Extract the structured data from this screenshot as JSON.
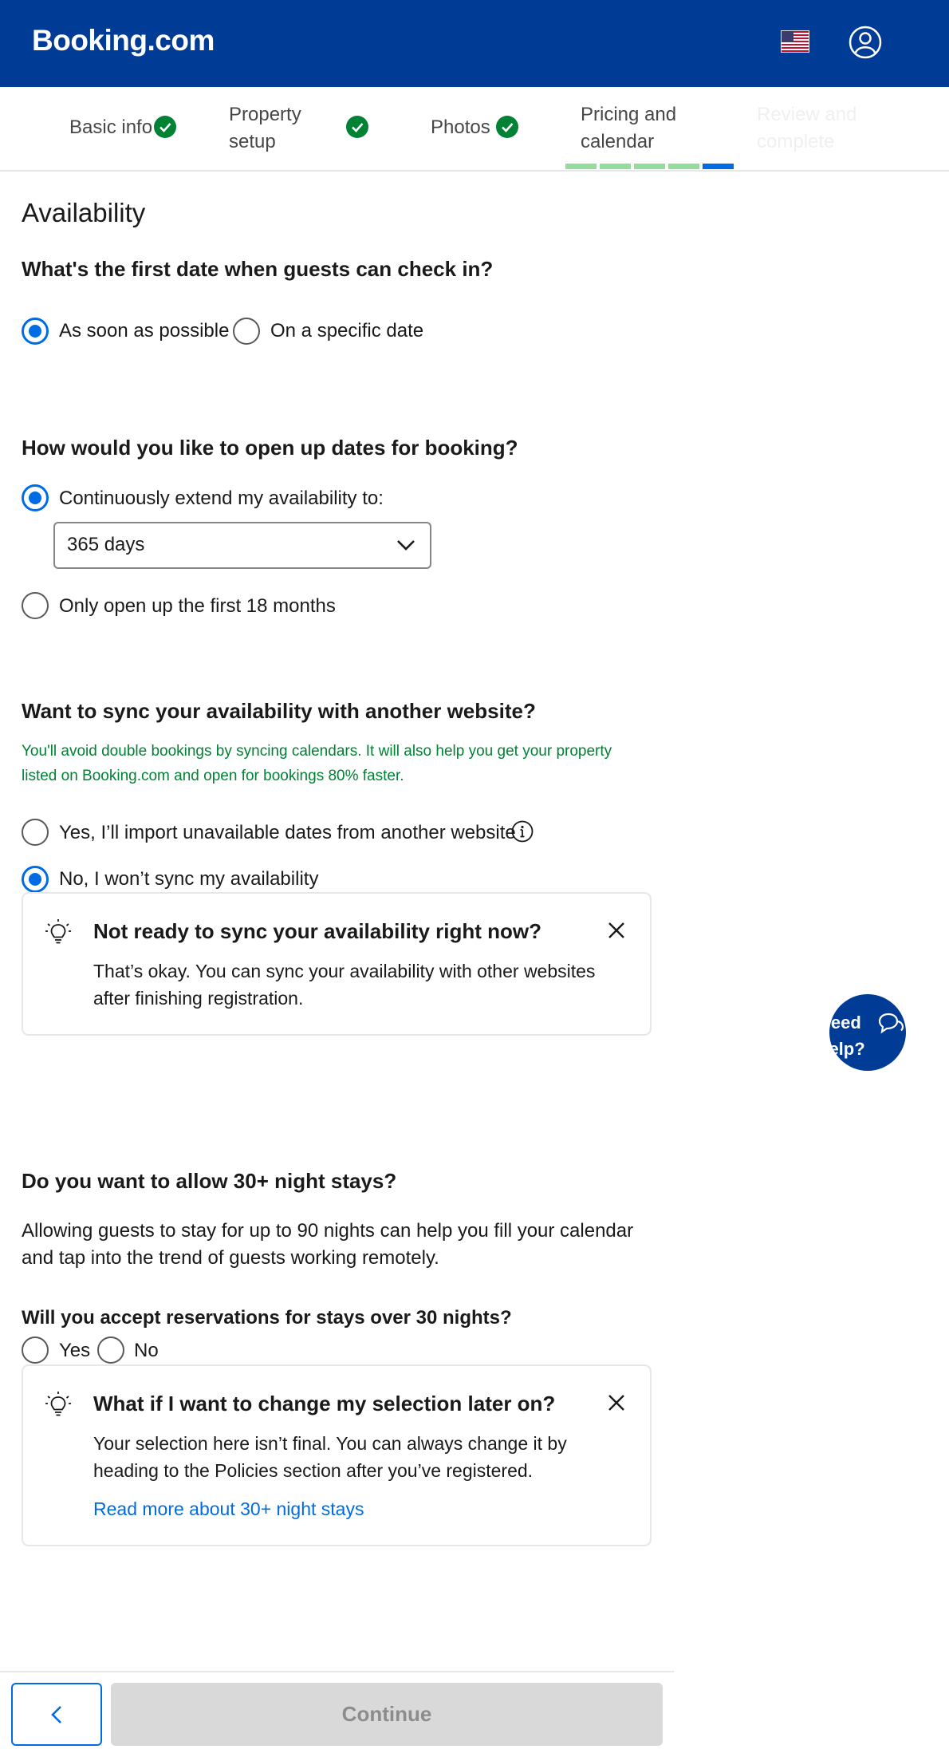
{
  "header": {
    "logo": "Booking.com",
    "language_icon": "us-flag-icon",
    "account_icon": "user-circle-icon"
  },
  "steps": [
    {
      "line1": "Basic info",
      "line2": "",
      "status": "complete"
    },
    {
      "line1": "Property",
      "line2": "setup",
      "status": "complete"
    },
    {
      "line1": "Photos",
      "line2": "",
      "status": "complete"
    },
    {
      "line1": "Pricing and",
      "line2": "calendar",
      "status": "current"
    },
    {
      "line1": "Review and",
      "line2": "complete",
      "status": "upcoming"
    }
  ],
  "step_progress": {
    "completed_segments": 4,
    "total_segments": 5
  },
  "section_title": "Availability",
  "checkin": {
    "question": "What's the first date when guests can check in?",
    "options": [
      {
        "label": "As soon as possible",
        "selected": true
      },
      {
        "label": "On a specific date",
        "selected": false
      }
    ]
  },
  "open_dates": {
    "question": "How would you like to open up dates for booking?",
    "option_extend": "Continuously extend my availability to:",
    "option_extend_selected": true,
    "select_value": "365 days",
    "option_18": "Only open up the first 18 months",
    "option_18_selected": false
  },
  "sync": {
    "question": "Want to sync your availability with another website?",
    "note": "You'll avoid double bookings by syncing calendars. It will also help you get your property listed on Booking.com and open for bookings 80% faster.",
    "option_yes": "Yes, I’ll import unavailable dates from another website",
    "option_no": "No, I won’t sync my availability",
    "selected": "no",
    "card_title": "Not ready to sync your availability right now?",
    "card_body": "That’s okay. You can sync your availability with other websites after finishing registration."
  },
  "long_stays": {
    "question": "Do you want to allow 30+ night stays?",
    "description": "Allowing guests to stay for up to 90 nights can help you fill your calendar and tap into the trend of guests working remotely.",
    "sub_question": "Will you accept reservations for stays over 30 nights?",
    "option_yes": "Yes",
    "option_no": "No",
    "card_title": "What if I want to change my selection later on?",
    "card_body": "Your selection here isn’t final. You can always change it by heading to the Policies section after you’ve registered.",
    "card_link": "Read more about 30+ night stays"
  },
  "help_button": {
    "text": "Need help?"
  },
  "footer": {
    "continue_label": "Continue",
    "back_icon": "chevron-left-icon"
  },
  "colors": {
    "brand": "#003b95",
    "accent": "#006ce4",
    "success": "#008234",
    "progress_complete": "#95dc9c"
  }
}
